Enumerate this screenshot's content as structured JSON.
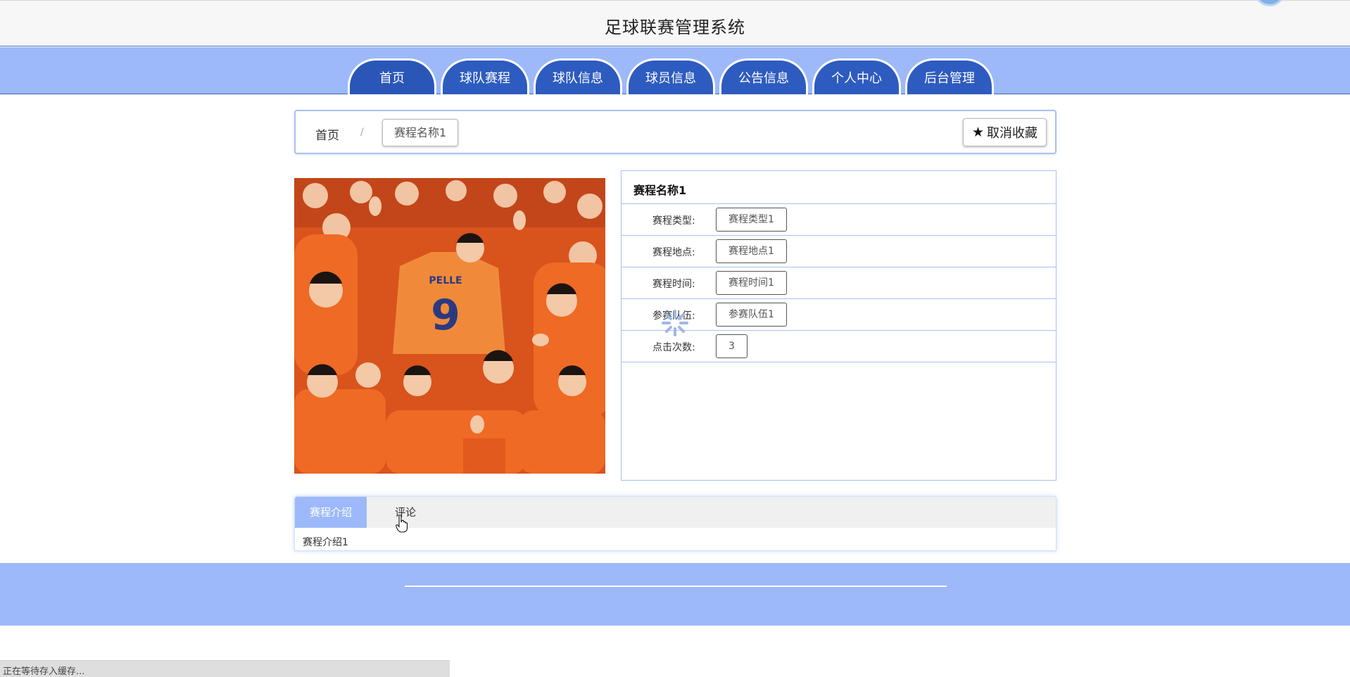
{
  "header": {
    "title": "足球联赛管理系统"
  },
  "nav": {
    "items": [
      {
        "label": "首页"
      },
      {
        "label": "球队赛程"
      },
      {
        "label": "球队信息"
      },
      {
        "label": "球员信息"
      },
      {
        "label": "公告信息"
      },
      {
        "label": "个人中心"
      },
      {
        "label": "后台管理"
      }
    ]
  },
  "breadcrumb": {
    "home": "首页",
    "separator": "/",
    "current": "赛程名称1"
  },
  "actions": {
    "favorite_label": "取消收藏",
    "favorite_icon": "star-icon"
  },
  "detail": {
    "title": "赛程名称1",
    "rows": [
      {
        "label": "赛程类型:",
        "value": "赛程类型1"
      },
      {
        "label": "赛程地点:",
        "value": "赛程地点1"
      },
      {
        "label": "赛程时间:",
        "value": "赛程时间1"
      },
      {
        "label": "参赛队伍:",
        "value": "参赛队伍1"
      },
      {
        "label": "点击次数:",
        "value": "3"
      }
    ]
  },
  "tabs": {
    "items": [
      {
        "label": "赛程介绍"
      },
      {
        "label": "评论"
      }
    ],
    "content": "赛程介绍1"
  },
  "status_bar": {
    "text": "正在等待存入缓存..."
  },
  "colors": {
    "accent": "#9db9f9",
    "nav_tab": "#2e5bbf",
    "border": "#a9c0f0"
  }
}
